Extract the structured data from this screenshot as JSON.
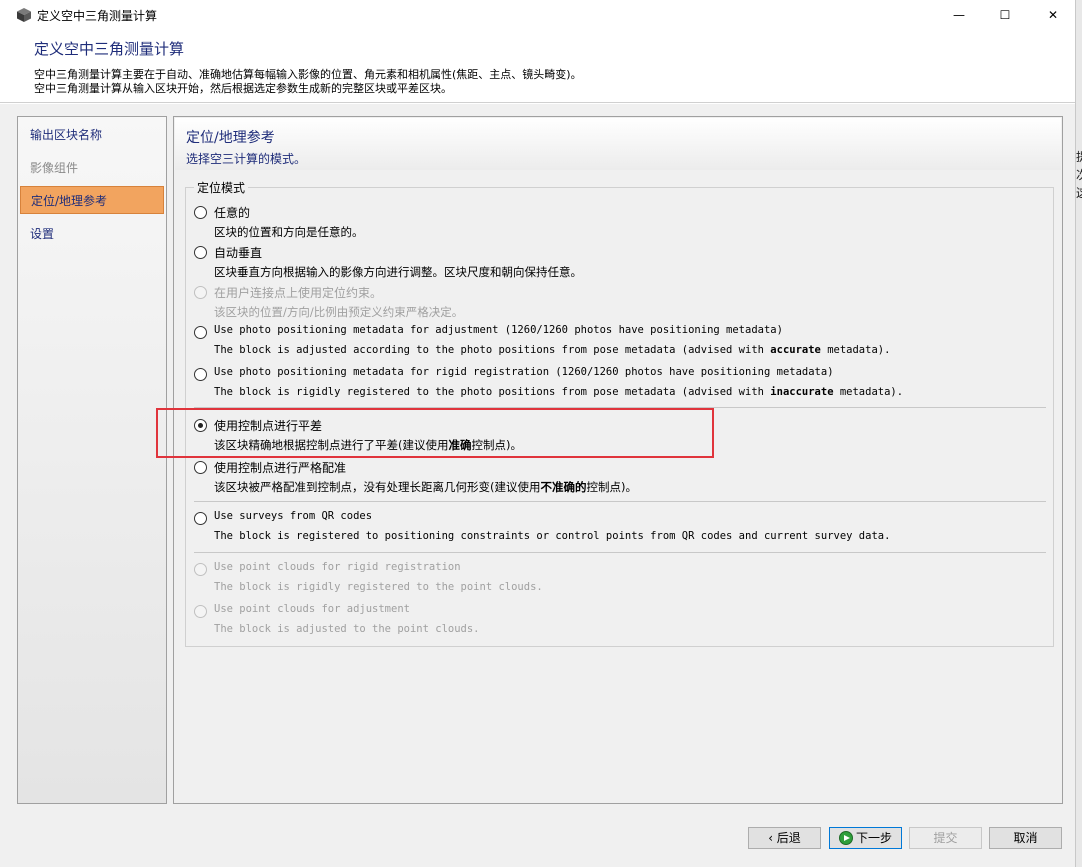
{
  "window": {
    "title": "定义空中三角测量计算",
    "minimize": "—",
    "maximize": "☐",
    "close": "✕"
  },
  "header": {
    "title": "定义空中三角测量计算",
    "desc_line1": "空中三角测量计算主要在于自动、准确地估算每幅输入影像的位置、角元素和相机属性(焦距、主点、镜头畸变)。",
    "desc_line2": "空中三角测量计算从输入区块开始，然后根据选定参数生成新的完整区块或平差区块。"
  },
  "sidebar": {
    "items": [
      {
        "label": "输出区块名称",
        "state": "normal"
      },
      {
        "label": "影像组件",
        "state": "disabled"
      },
      {
        "label": "定位/地理参考",
        "state": "active"
      },
      {
        "label": "设置",
        "state": "normal"
      }
    ]
  },
  "panel": {
    "title": "定位/地理参考",
    "subtitle": "选择空三计算的模式。",
    "group_title": "定位模式"
  },
  "options": [
    {
      "label": "任意的",
      "desc": "区块的位置和方向是任意的。"
    },
    {
      "label": "自动垂直",
      "desc": "区块垂直方向根据输入的影像方向进行调整。区块尺度和朝向保持任意。"
    },
    {
      "label": "在用户连接点上使用定位约束。",
      "desc": "该区块的位置/方向/比例由预定义约束严格决定。"
    },
    {
      "label": "Use photo positioning metadata for adjustment (1260/1260 photos have positioning metadata)",
      "desc_pre": "The block is adjusted according to the photo positions from pose metadata (advised with ",
      "desc_bold": "accurate",
      "desc_post": " metadata)."
    },
    {
      "label": "Use photo positioning metadata for rigid registration (1260/1260 photos have positioning metadata)",
      "desc_pre": "The block is rigidly registered to the photo positions from pose metadata (advised with ",
      "desc_bold": "inaccurate",
      "desc_post": " metadata)."
    },
    {
      "label": "使用控制点进行平差",
      "desc_pre": "该区块精确地根据控制点进行了平差(建议使用",
      "desc_bold": "准确",
      "desc_post": "控制点)。"
    },
    {
      "label": "使用控制点进行严格配准",
      "desc_pre": "该区块被严格配准到控制点，没有处理长距离几何形变(建议使用",
      "desc_bold": "不准确的",
      "desc_post": "控制点)。"
    },
    {
      "label": "Use surveys from QR codes",
      "desc": "The block is registered to positioning constraints or control points from QR codes and current survey data."
    },
    {
      "label": "Use point clouds for rigid registration",
      "desc": "The block is rigidly registered to the point clouds."
    },
    {
      "label": "Use point clouds for adjustment",
      "desc": "The block is adjusted to the point clouds."
    }
  ],
  "buttons": {
    "back": "‹ 后退",
    "next": "下一步",
    "submit": "提交",
    "cancel": "取消"
  },
  "right_edge_glyphs": [
    "提",
    "次",
    "这"
  ]
}
